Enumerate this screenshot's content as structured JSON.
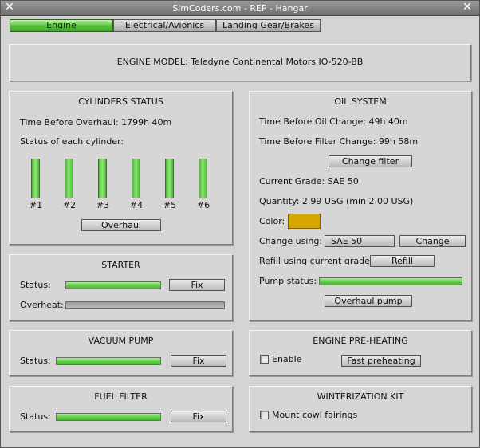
{
  "window": {
    "title": "SimCoders.com - REP - Hangar",
    "close_left_glyph": "✕",
    "close_right_glyph": "✕"
  },
  "tabs": [
    {
      "label": "Engine",
      "active": true
    },
    {
      "label": "Electrical/Avionics",
      "active": false
    },
    {
      "label": "Landing Gear/Brakes",
      "active": false
    }
  ],
  "engine_model": {
    "text": "ENGINE MODEL: Teledyne Continental Motors IO-520-BB"
  },
  "cylinders": {
    "title": "CYLINDERS STATUS",
    "tbo_text": "Time Before Overhaul: 1799h 40m",
    "status_label": "Status of each cylinder:",
    "items": [
      {
        "label": "#1",
        "level": 1.0
      },
      {
        "label": "#2",
        "level": 1.0
      },
      {
        "label": "#3",
        "level": 1.0
      },
      {
        "label": "#4",
        "level": 1.0
      },
      {
        "label": "#5",
        "level": 1.0
      },
      {
        "label": "#6",
        "level": 1.0
      }
    ],
    "overhaul_label": "Overhaul"
  },
  "starter": {
    "title": "STARTER",
    "status_label": "Status:",
    "status_level": 1.0,
    "fix_label": "Fix",
    "overheat_label": "Overheat:",
    "overheat_level": 0.0
  },
  "vacuum_pump": {
    "title": "VACUUM PUMP",
    "status_label": "Status:",
    "status_level": 1.0,
    "fix_label": "Fix"
  },
  "fuel_filter": {
    "title": "FUEL FILTER",
    "status_label": "Status:",
    "status_level": 1.0,
    "fix_label": "Fix"
  },
  "oil_system": {
    "title": "OIL SYSTEM",
    "oil_change_text": "Time Before Oil Change: 49h 40m",
    "filter_change_text": "Time Before Filter Change: 99h 58m",
    "change_filter_label": "Change filter",
    "grade_text": "Current Grade: SAE 50",
    "quantity_text": "Quantity: 2.99 USG (min 2.00 USG)",
    "color_label": "Color:",
    "oil_color": "#d9a600",
    "change_using_label": "Change using:",
    "change_using_value": "SAE  50",
    "change_label": "Change",
    "refill_label_text": "Refill using current grade:",
    "refill_label": "Refill",
    "pump_status_label": "Pump status:",
    "pump_level": 1.0,
    "overhaul_pump_label": "Overhaul pump"
  },
  "preheating": {
    "title": "ENGINE PRE-HEATING",
    "enable_label": "Enable",
    "enable_checked": false,
    "fast_preheating_label": "Fast preheating"
  },
  "winterization": {
    "title": "WINTERIZATION KIT",
    "mount_label": "Mount cowl fairings",
    "mount_checked": false
  }
}
